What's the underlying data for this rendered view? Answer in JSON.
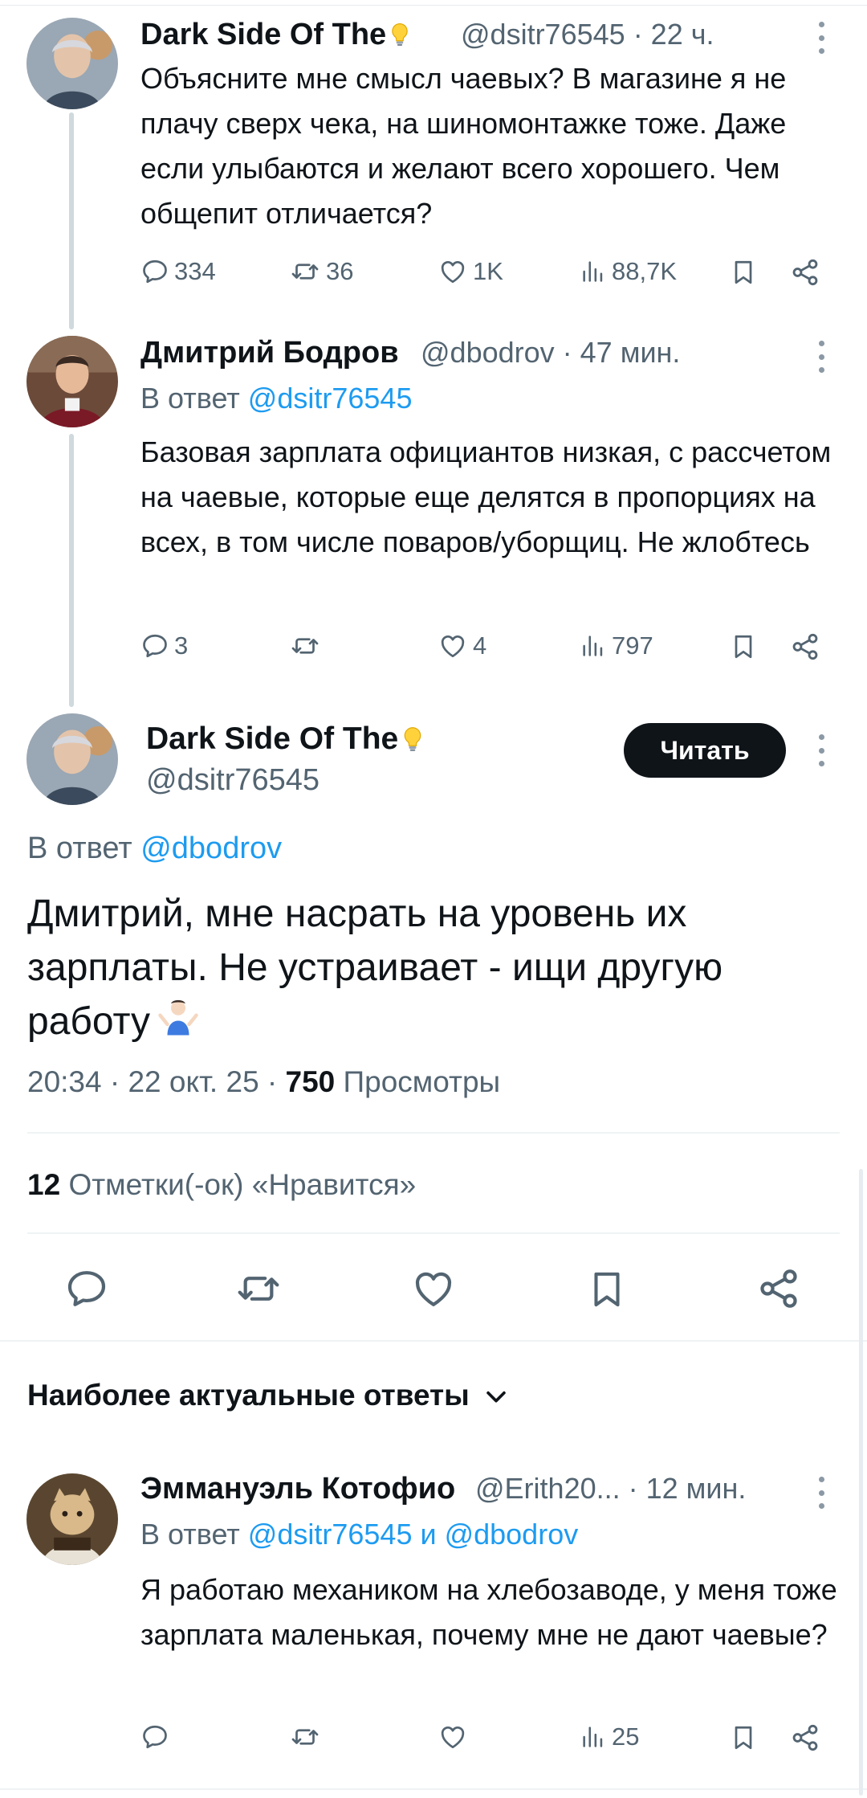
{
  "tweet1": {
    "name": "Dark Side Of The",
    "handle": "@dsitr76545",
    "time": "· 22 ч.",
    "text": "Объясните мне смысл чаевых? В магазине я не плачу сверх чека, на шиномонтажке тоже. Даже если улыбаются и желают всего хорошего. Чем общепит отличается?",
    "replies": "334",
    "retweets": "36",
    "likes": "1K",
    "views": "88,7K"
  },
  "tweet2": {
    "name": "Дмитрий Бодров",
    "handle": "@dbodrov",
    "time": "· 47 мин.",
    "reply_prefix": "В ответ",
    "reply_to": "@dsitr76545",
    "text": "Базовая зарплата официантов низкая, с рассчетом на чаевые, которые еще делятся в пропорциях на всех, в том числе поваров/уборщиц. Не жлобтесь",
    "replies": "3",
    "retweets": "",
    "likes": "4",
    "views": "797"
  },
  "main_tweet": {
    "name": "Dark Side Of The",
    "handle": "@dsitr76545",
    "follow_label": "Читать",
    "reply_prefix": "В ответ",
    "reply_to": "@dbodrov",
    "text": "Дмитрий, мне насрать на уровень их зарплаты. Не устраивает - ищи другую работу",
    "timestamp": "20:34 · 22 окт. 25 ·",
    "views_count": "750",
    "views_label": "Просмотры",
    "likes_count": "12",
    "likes_label": "Отметки(-ок) «Нравится»"
  },
  "replies_sort": {
    "label": "Наиболее актуальные ответы"
  },
  "tweet3": {
    "name": "Эммануэль Котофио",
    "handle": "@Erith20...",
    "time": "· 12 мин.",
    "reply_prefix": "В ответ",
    "reply_to": "@dsitr76545 и @dbodrov",
    "text": "Я работаю  механиком на хлебозаводе, у меня тоже зарплата маленькая, почему мне не дают чаевые?",
    "views": "25"
  },
  "colors": {
    "accent": "#1d9bf0",
    "text": "#0f1419",
    "muted": "#536471"
  },
  "icons": [
    "reply-icon",
    "retweet-icon",
    "like-icon",
    "views-icon",
    "bookmark-icon",
    "share-icon",
    "more-icon",
    "lightbulb-icon",
    "chevron-down-icon",
    "shrug-emoji"
  ]
}
